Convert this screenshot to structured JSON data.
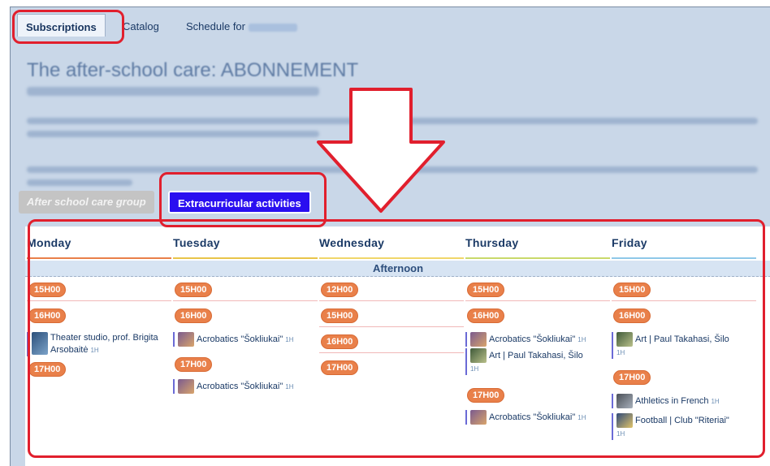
{
  "tabs": [
    {
      "label": "Subscriptions"
    },
    {
      "label": "Catalog"
    },
    {
      "label": "Schedule for"
    }
  ],
  "intro": {
    "title": "The after-school care: ABONNEMENT"
  },
  "groups": {
    "after_school": "After school care group",
    "extracurricular": "Extracurricular activities"
  },
  "schedule": {
    "band": "Afternoon",
    "duration_label": "1H",
    "days": [
      {
        "name": "Monday",
        "rule_color": "#e9804a",
        "slots": [
          "15H00",
          "16H00",
          "17H00"
        ],
        "activities": [
          {
            "title": "Theater studio, prof. Brigita Arsobaitė"
          }
        ]
      },
      {
        "name": "Tuesday",
        "rule_color": "#e8c44a",
        "slots": [
          "15H00",
          "16H00",
          "17H00"
        ],
        "activities": [
          {
            "title": "Acrobatics \"Šokliukai\""
          },
          {
            "title": "Acrobatics \"Šokliukai\""
          }
        ]
      },
      {
        "name": "Wednesday",
        "rule_color": "#f0d66a",
        "slots": [
          "12H00",
          "15H00",
          "16H00",
          "17H00"
        ],
        "activities": []
      },
      {
        "name": "Thursday",
        "rule_color": "#c9d96b",
        "slots": [
          "15H00",
          "16H00",
          "17H00"
        ],
        "activities": [
          {
            "title": "Acrobatics \"Šokliukai\""
          },
          {
            "title": "Art | Paul Takahasi, Šilo"
          },
          {
            "title": "Acrobatics \"Šokliukai\""
          }
        ]
      },
      {
        "name": "Friday",
        "rule_color": "#8fc8e8",
        "slots": [
          "15H00",
          "16H00",
          "17H00"
        ],
        "activities": [
          {
            "title": "Art | Paul Takahasi, Šilo"
          },
          {
            "title": "Athletics in French"
          },
          {
            "title": "Football | Club \"Riteriai\""
          }
        ]
      }
    ]
  },
  "colors": {
    "accent_blue": "#2a0ff0",
    "pill_orange": "#e9804a",
    "annotation_red": "#e11f2d"
  }
}
